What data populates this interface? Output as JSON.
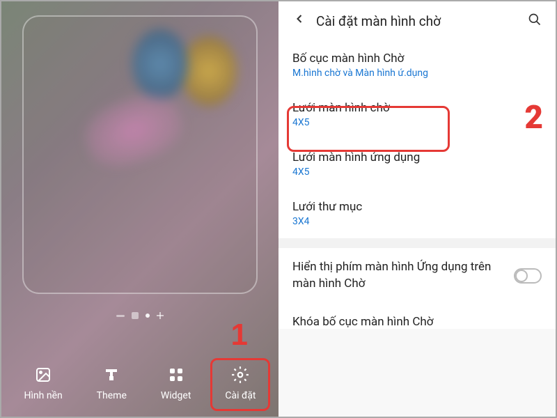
{
  "left": {
    "toolbar": {
      "wallpaper": "Hình nền",
      "theme": "Theme",
      "widget": "Widget",
      "settings": "Cài đặt"
    },
    "annotation1": "1"
  },
  "right": {
    "header_title": "Cài đặt màn hình chờ",
    "items": {
      "layout": {
        "title": "Bố cục màn hình Chờ",
        "value": "M.hình chờ và Màn hình ứ.dụng"
      },
      "home_grid": {
        "title": "Lưới màn hình chờ",
        "value": "4X5"
      },
      "apps_grid": {
        "title": "Lưới màn hình ứng dụng",
        "value": "4X5"
      },
      "folder_grid": {
        "title": "Lưới thư mục",
        "value": "3X4"
      },
      "apps_button": {
        "title": "Hiển thị phím màn hình Ứng dụng trên màn hình Chờ"
      },
      "lock_layout": {
        "title": "Khóa bố cục màn hình Chờ"
      }
    },
    "annotation2": "2"
  }
}
